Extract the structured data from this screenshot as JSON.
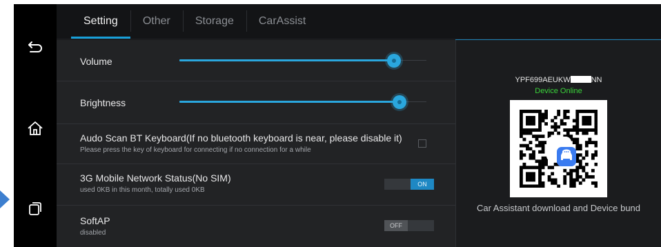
{
  "nav": {
    "back_icon": "back-arrow-icon",
    "home_icon": "home-icon",
    "recents_icon": "recent-apps-icon"
  },
  "tabs": [
    {
      "label": "Setting",
      "active": true
    },
    {
      "label": "Other",
      "active": false
    },
    {
      "label": "Storage",
      "active": false
    },
    {
      "label": "CarAssist",
      "active": false
    }
  ],
  "settings": {
    "volume": {
      "label": "Volume",
      "level": 0.87
    },
    "brightness": {
      "label": "Brightness",
      "level": 0.89
    },
    "bt_keyboard": {
      "title": "Audo Scan BT Keyboard(If no bluetooth keyboard is near, please disable it)",
      "subtitle": "Please press the key of keyboard for connecting if no connection for a while",
      "checked": false
    },
    "mobile_network": {
      "title": "3G Mobile Network Status(No SIM)",
      "subtitle": "used 0KB in this month, totally used 0KB",
      "toggle_label": "ON",
      "state": "on"
    },
    "softap": {
      "title": "SoftAP",
      "subtitle": "disabled",
      "toggle_label": "OFF",
      "state": "off"
    }
  },
  "device": {
    "id_prefix": "YPF699AEUKW",
    "id_suffix": "NN",
    "status": "Device Online",
    "caption": "Car Assistant download and Device bund",
    "qr_badge_icon": "car-assistant-logo-icon"
  },
  "colors": {
    "accent": "#2aa7de",
    "online": "#3bd53b",
    "toggle_on": "#1e88c4"
  }
}
